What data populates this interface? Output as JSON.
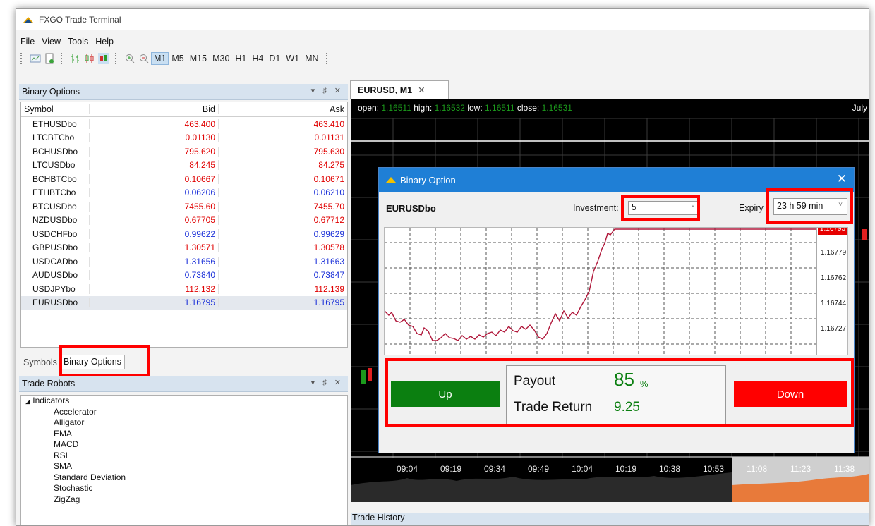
{
  "app": {
    "title": "FXGO Trade Terminal"
  },
  "menu": [
    "File",
    "View",
    "Tools",
    "Help"
  ],
  "timeframes": [
    "M1",
    "M5",
    "M15",
    "M30",
    "H1",
    "H4",
    "D1",
    "W1",
    "MN"
  ],
  "binary_panel": {
    "title": "Binary Options",
    "columns": [
      "Symbol",
      "Bid",
      "Ask"
    ],
    "rows": [
      {
        "symbol": "ETHUSDbo",
        "bid": "463.400",
        "ask": "463.410",
        "color": "#e00000"
      },
      {
        "symbol": "LTCBTCbo",
        "bid": "0.01130",
        "ask": "0.01131",
        "color": "#e00000"
      },
      {
        "symbol": "BCHUSDbo",
        "bid": "795.620",
        "ask": "795.630",
        "color": "#e00000"
      },
      {
        "symbol": "LTCUSDbo",
        "bid": "84.245",
        "ask": "84.275",
        "color": "#e00000"
      },
      {
        "symbol": "BCHBTCbo",
        "bid": "0.10667",
        "ask": "0.10671",
        "color": "#e00000"
      },
      {
        "symbol": "ETHBTCbo",
        "bid": "0.06206",
        "ask": "0.06210",
        "color": "#1a2fd8"
      },
      {
        "symbol": "BTCUSDbo",
        "bid": "7455.60",
        "ask": "7455.70",
        "color": "#e00000"
      },
      {
        "symbol": "NZDUSDbo",
        "bid": "0.67705",
        "ask": "0.67712",
        "color": "#e00000"
      },
      {
        "symbol": "USDCHFbo",
        "bid": "0.99622",
        "ask": "0.99629",
        "color": "#1a2fd8"
      },
      {
        "symbol": "GBPUSDbo",
        "bid": "1.30571",
        "ask": "1.30578",
        "color": "#e00000"
      },
      {
        "symbol": "USDCADbo",
        "bid": "1.31656",
        "ask": "1.31663",
        "color": "#1a2fd8"
      },
      {
        "symbol": "AUDUSDbo",
        "bid": "0.73840",
        "ask": "0.73847",
        "color": "#1a2fd8"
      },
      {
        "symbol": "USDJPYbo",
        "bid": "112.132",
        "ask": "112.139",
        "color": "#e00000"
      },
      {
        "symbol": "EURUSDbo",
        "bid": "1.16795",
        "ask": "1.16795",
        "color": "#1a2fd8",
        "selected": true
      }
    ],
    "tabs": [
      "Symbols",
      "Binary Options"
    ]
  },
  "robots_panel": {
    "title": "Trade Robots",
    "root": "Indicators",
    "items": [
      "Accelerator",
      "Alligator",
      "EMA",
      "MACD",
      "RSI",
      "SMA",
      "Standard Deviation",
      "Stochastic",
      "ZigZag"
    ]
  },
  "chart": {
    "tab": "EURUSD, M1",
    "ohlc": {
      "open_label": "open:",
      "open": "1.16511",
      "high_label": "high:",
      "high": "1.16532",
      "low_label": "low:",
      "low": "1.16511",
      "close_label": "close:",
      "close": "1.16531"
    },
    "corner_label": "July",
    "time_ticks": [
      "09:04",
      "09:19",
      "09:34",
      "09:49",
      "10:04",
      "10:19",
      "10:38",
      "10:53",
      "11:08",
      "11:23",
      "11:38"
    ]
  },
  "trade_history": {
    "title": "Trade History"
  },
  "dialog": {
    "title": "Binary Option",
    "symbol": "EURUSDbo",
    "investment_label": "Investment:",
    "investment_value": "5",
    "expiry_label": "Expiry",
    "expiry_value": "23 h 59 min",
    "price_ticks": [
      "1.16795",
      "1.16779",
      "1.16762",
      "1.16744",
      "1.16727"
    ],
    "up_label": "Up",
    "down_label": "Down",
    "payout_label": "Payout",
    "payout_value": "85",
    "payout_unit": "%",
    "trade_return_label": "Trade Return",
    "trade_return_value": "9.25"
  },
  "colors": {
    "accent": "#1f7fd6",
    "up": "#0b7f10",
    "down": "#ff0000",
    "highlight": "#ff0000"
  }
}
